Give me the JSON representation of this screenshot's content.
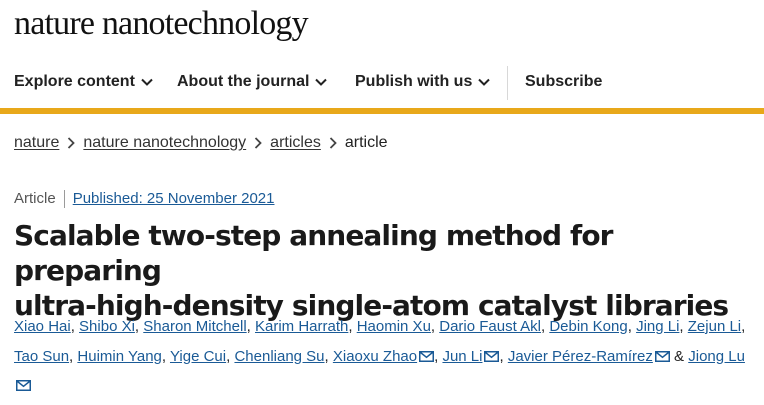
{
  "journal": {
    "logo_text": "nature nanotechnology"
  },
  "nav": {
    "explore": "Explore content",
    "about": "About the journal",
    "publish": "Publish with us",
    "subscribe": "Subscribe"
  },
  "breadcrumb": {
    "items": [
      "nature",
      "nature nanotechnology",
      "articles"
    ],
    "current": "article"
  },
  "article": {
    "type": "Article",
    "published": "Published: 25 November 2021",
    "title_line1": "Scalable two-step annealing method for preparing",
    "title_line2": "ultra-high-density single-atom catalyst libraries"
  },
  "authors": {
    "names": [
      "Xiao Hai",
      "Shibo Xi",
      "Sharon Mitchell",
      "Karim Harrath",
      "Haomin Xu",
      "Dario Faust Akl",
      "Debin Kong",
      "Jing Li",
      "Zejun Li",
      "Tao Sun",
      "Huimin Yang",
      "Yige Cui",
      "Chenliang Su",
      "Xiaoxu Zhao",
      "Jun Li",
      "Javier Pérez-Ramírez",
      "Jiong Lu"
    ],
    "separator": ",",
    "conjunction": "&"
  },
  "colors": {
    "accent": "#e8a81a",
    "link": "#1a5a96",
    "text": "#222222"
  },
  "icons": {
    "nav_dropdown": "chevron-down-icon",
    "breadcrumb_sep": "chevron-right-icon",
    "author_contact": "mail-icon"
  }
}
